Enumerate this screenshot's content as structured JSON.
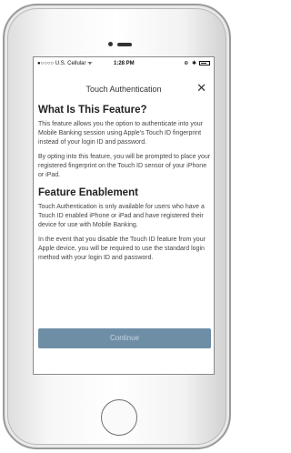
{
  "status_bar": {
    "carrier": "●○○○○ U.S. Cellular ᯤ",
    "time": "1:28 PM",
    "icons": "⊕ ✱"
  },
  "nav": {
    "title": "Touch Authentication",
    "close_label": "✕"
  },
  "section1": {
    "heading": "What Is This Feature?",
    "p1": "This feature allows you the option to authenticate into your Mobile Banking session using Apple’s Touch ID fingerprint instead of your login ID and password.",
    "p2": "By opting into this feature, you will be prompted to place your registered fingerprint on the Touch ID sensor of your iPhone or iPad."
  },
  "section2": {
    "heading": "Feature Enablement",
    "p1": "Touch Authentication is only available for users who have a Touch ID enabled iPhone or iPad and have registered their device for use with Mobile Banking.",
    "p2": "In the event that you disable the Touch ID feature from your Apple device, you will be required to use the standard login method with your login ID and password."
  },
  "continue_label": "Continue",
  "colors": {
    "button": "#6e8ea6",
    "button_text": "#c9d6e0"
  }
}
